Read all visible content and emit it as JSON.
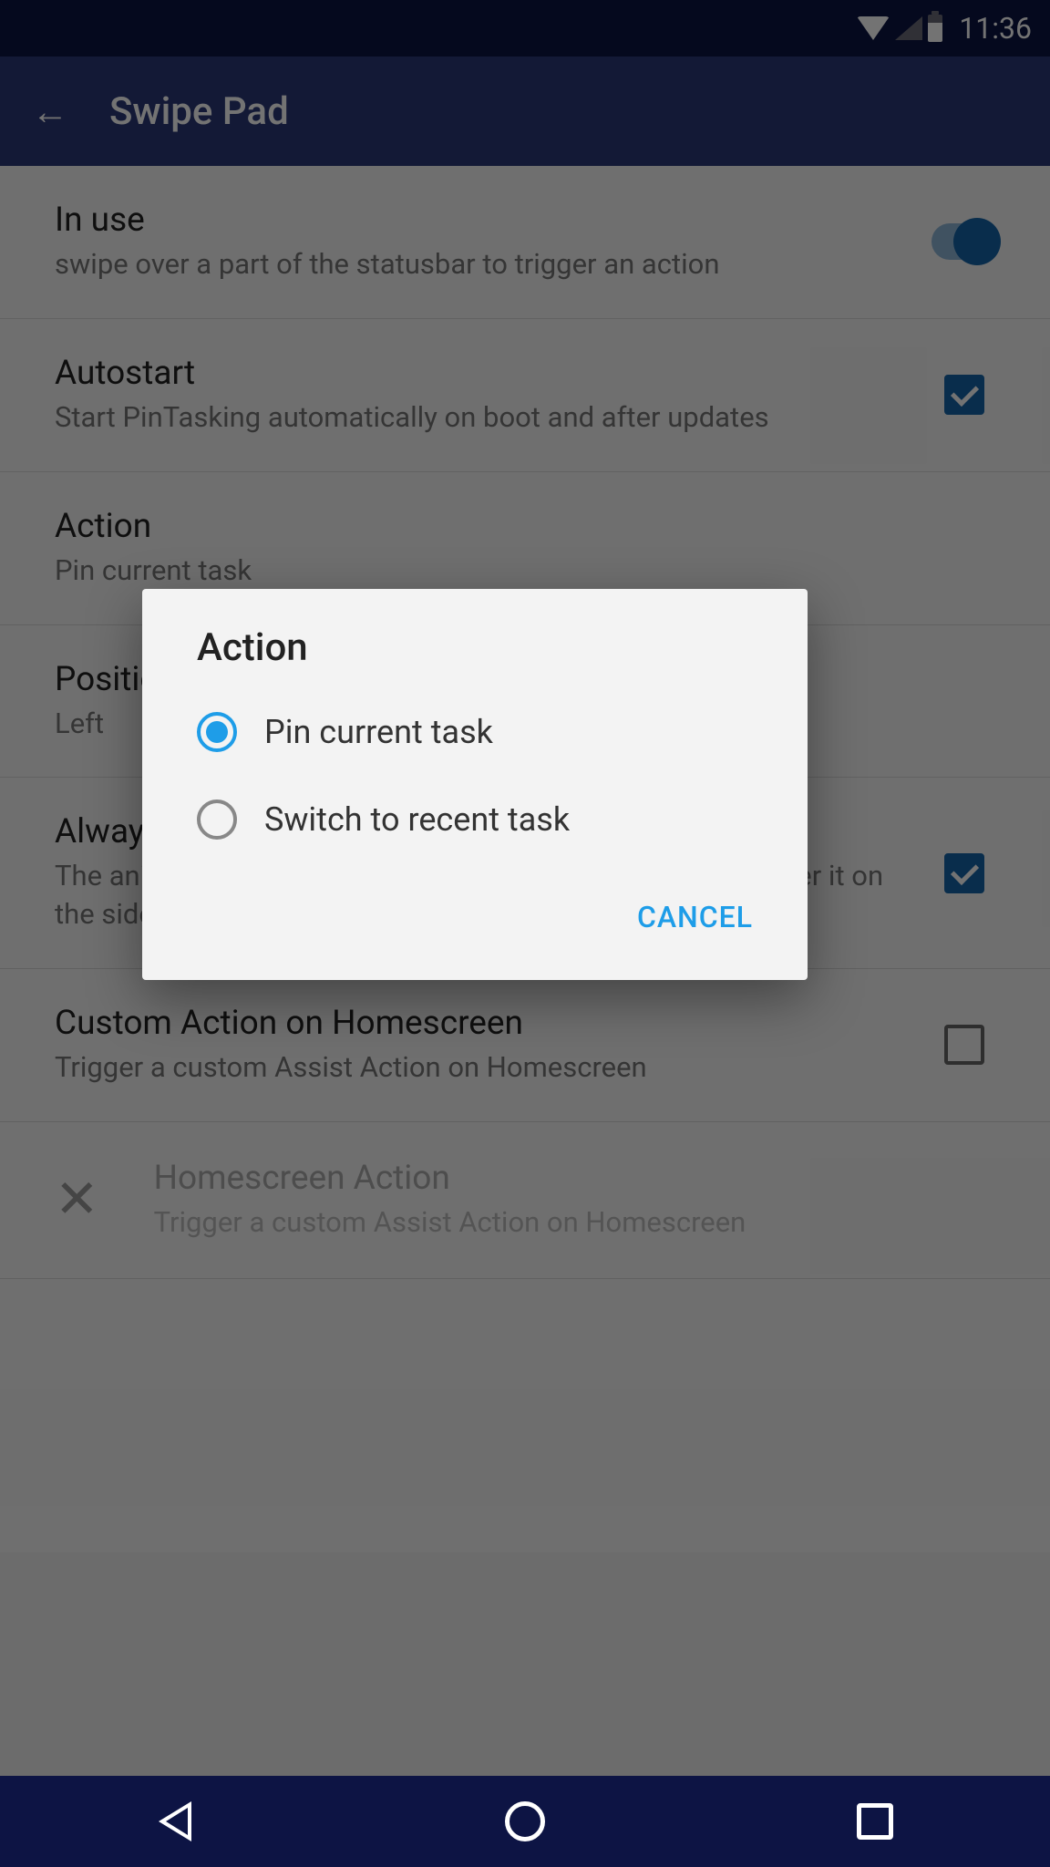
{
  "statusbar": {
    "time": "11:36"
  },
  "appbar": {
    "title": "Swipe Pad"
  },
  "settings": [
    {
      "title": "In use",
      "subtitle": "swipe over a part of the statusbar to trigger an action"
    },
    {
      "title": "Autostart",
      "subtitle": "Start PinTasking automatically on boot and after updates"
    },
    {
      "title": "Action",
      "subtitle": "Pin current task"
    },
    {
      "title": "Position",
      "subtitle": "Left"
    },
    {
      "title": "Always center",
      "subtitle": "The animation will appear in the center even when you trigger it on the sides"
    },
    {
      "title": "Custom Action on Homescreen",
      "subtitle": "Trigger a custom Assist Action on Homescreen"
    },
    {
      "title": "Homescreen Action",
      "subtitle": "Trigger a custom Assist Action on Homescreen"
    }
  ],
  "dialog": {
    "title": "Action",
    "options": [
      "Pin current task",
      "Switch to recent task"
    ],
    "cancel": "CANCEL",
    "selected": 0
  }
}
